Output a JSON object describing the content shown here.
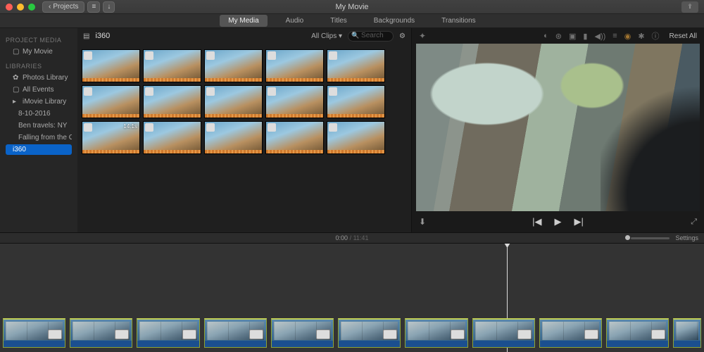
{
  "titlebar": {
    "back_label": "Projects",
    "title": "My Movie"
  },
  "tabs": {
    "my_media": "My Media",
    "audio": "Audio",
    "titles": "Titles",
    "backgrounds": "Backgrounds",
    "transitions": "Transitions"
  },
  "sidebar": {
    "hdr1": "PROJECT MEDIA",
    "project": "My Movie",
    "hdr2": "LIBRARIES",
    "photos": "Photos Library",
    "all_events": "All Events",
    "imovie_lib": "iMovie Library",
    "evt1": "8-10-2016",
    "evt2": "Ben travels: NY",
    "evt3": "Falling from the Orbit",
    "evt4": "i360"
  },
  "browser": {
    "crumb": "i360",
    "filter": "All Clips",
    "search_placeholder": "Search",
    "clip_dur": "14.1s"
  },
  "preview": {
    "reset": "Reset All"
  },
  "timeline": {
    "pos": "0:00",
    "dur": "11:41",
    "settings": "Settings"
  },
  "icons": {
    "back": "‹",
    "list": "≡",
    "down": "↓",
    "share": "⇪",
    "wand": "✦",
    "balance": "◐",
    "globe": "⊛",
    "crop": "▣",
    "camera": "▮",
    "volume": "◀))",
    "eq": "≡",
    "speed": "◉",
    "fx": "✱",
    "info": "ⓘ",
    "photos": "✿",
    "events": "▢",
    "star_lib": "▸",
    "mic": "⬇",
    "prev": "|◀",
    "play": "▶",
    "next": "▶|",
    "full": "⤢",
    "gear": "⚙",
    "dropdown": "▾",
    "listview": "▤"
  }
}
